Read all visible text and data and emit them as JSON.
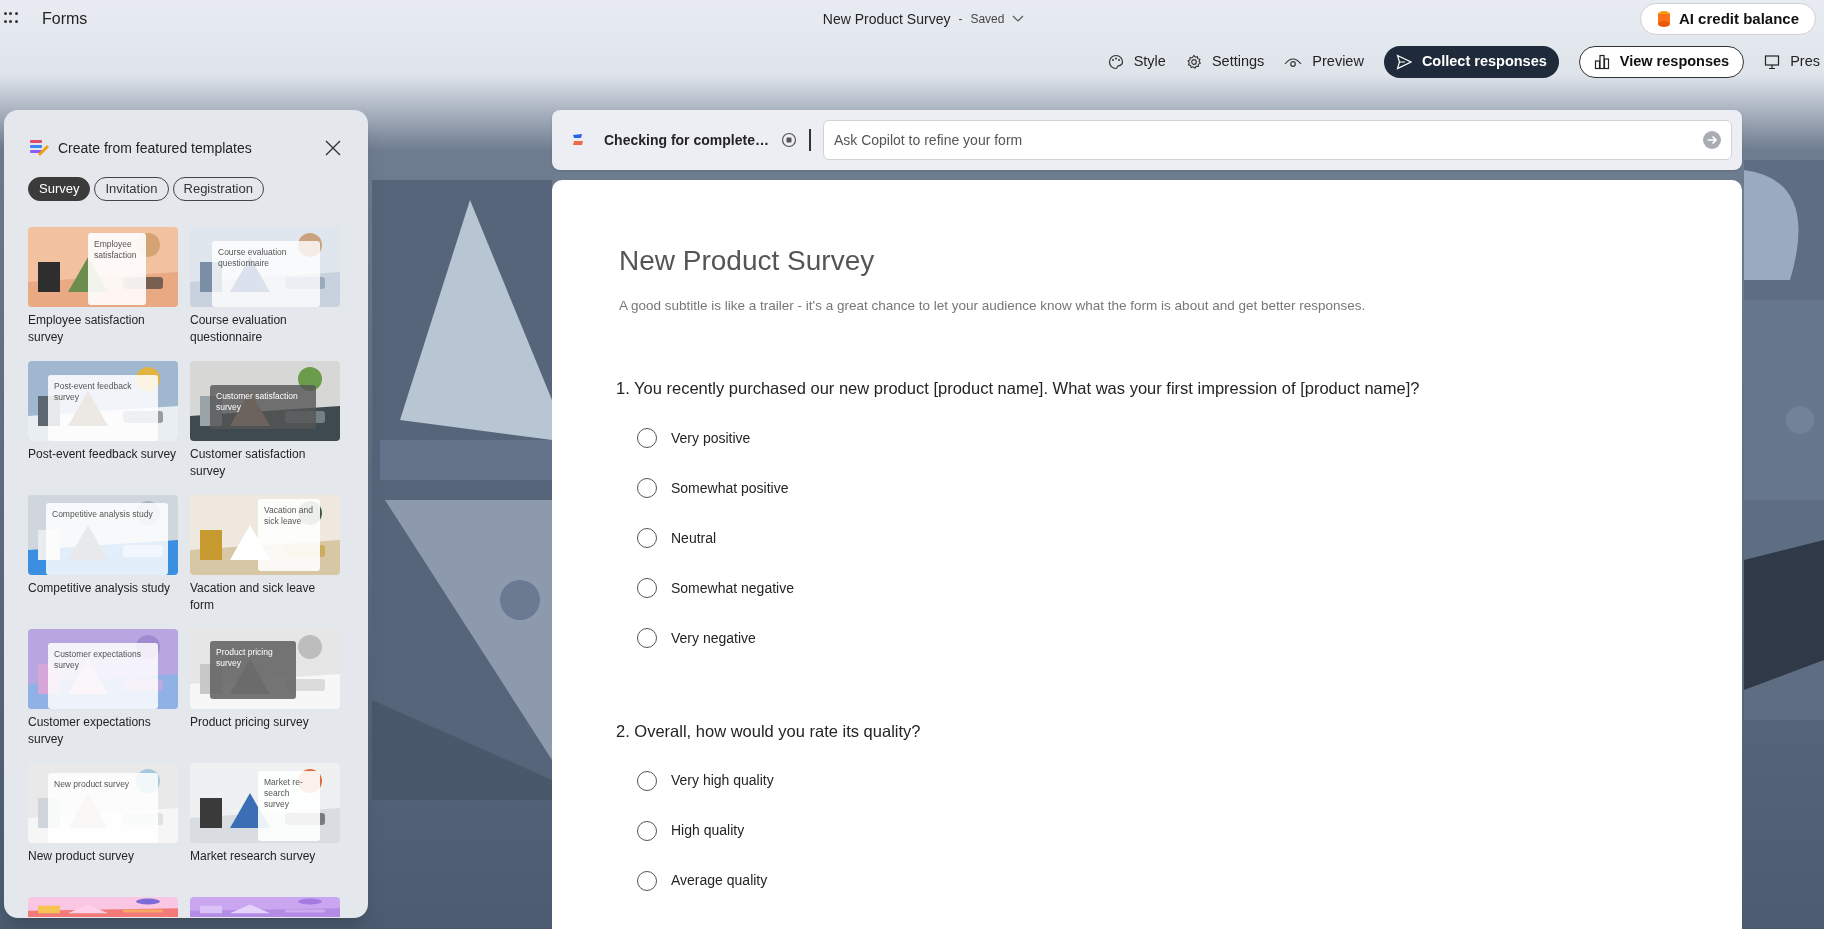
{
  "app": {
    "name": "Forms"
  },
  "document": {
    "title": "New Product Survey",
    "separator": "-",
    "status": "Saved"
  },
  "credit_button": {
    "label": "AI credit balance"
  },
  "toolbar": [
    {
      "label": "Style",
      "kind": "plain"
    },
    {
      "label": "Settings",
      "kind": "plain"
    },
    {
      "label": "Preview",
      "kind": "plain"
    },
    {
      "label": "Collect responses",
      "kind": "primary"
    },
    {
      "label": "View responses",
      "kind": "outline"
    },
    {
      "label": "Pres",
      "kind": "plain"
    }
  ],
  "copilot": {
    "status": "Checking for complete…",
    "placeholder": "Ask Copilot to refine your form"
  },
  "templates_panel": {
    "title": "Create from featured templates",
    "tabs": [
      {
        "label": "Survey",
        "selected": true
      },
      {
        "label": "Invitation",
        "selected": false
      },
      {
        "label": "Registration",
        "selected": false
      }
    ],
    "templates": [
      {
        "label": "Employee satisfaction survey",
        "thumb_title": "Employee satisfaction"
      },
      {
        "label": "Course evaluation questionnaire",
        "thumb_title": "Course evaluation questionnaire"
      },
      {
        "label": "Post-event feedback survey",
        "thumb_title": "Post-event feedback survey"
      },
      {
        "label": "Customer satisfaction survey",
        "thumb_title": "Customer satisfaction survey"
      },
      {
        "label": "Competitive analysis study",
        "thumb_title": "Competitive analysis study"
      },
      {
        "label": "Vacation and sick leave form",
        "thumb_title": "Vacation and sick leave"
      },
      {
        "label": "Customer expectations survey",
        "thumb_title": "Customer expectations survey"
      },
      {
        "label": "Product pricing survey",
        "thumb_title": "Product pricing survey"
      },
      {
        "label": "New product survey",
        "thumb_title": "New product survey"
      },
      {
        "label": "Market research survey",
        "thumb_title": "Market re-search survey"
      }
    ]
  },
  "form": {
    "title": "New Product Survey",
    "subtitle": "A good subtitle is like a trailer - it's a great chance to let your audience know what the form is about and get better responses.",
    "questions": [
      {
        "text": "1. You recently purchased our new product [product name]. What was your first impression of [product name]?",
        "options": [
          {
            "label": "Very positive",
            "selected": false
          },
          {
            "label": "Somewhat positive",
            "selected": false
          },
          {
            "label": "Neutral",
            "selected": false
          },
          {
            "label": "Somewhat negative",
            "selected": false
          },
          {
            "label": "Very negative",
            "selected": false
          }
        ]
      },
      {
        "text": "2. Overall, how would you rate its quality?",
        "options": [
          {
            "label": "Very high quality",
            "selected": false
          },
          {
            "label": "High quality",
            "selected": false
          },
          {
            "label": "Average quality",
            "selected": false
          }
        ]
      }
    ]
  }
}
